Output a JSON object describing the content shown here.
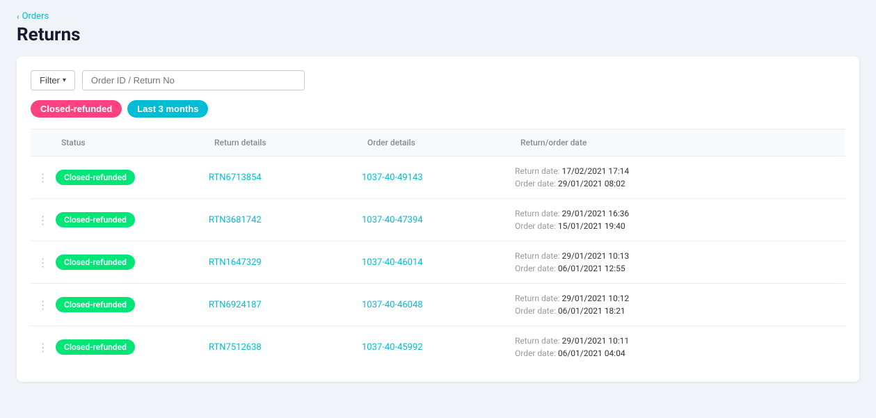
{
  "breadcrumb": {
    "chevron": "‹",
    "label": "Orders"
  },
  "page_title": "Returns",
  "filter": {
    "label": "Filter",
    "chevron": "▾",
    "placeholder": "Order ID / Return No"
  },
  "active_tags": [
    {
      "id": "tag-closed-refunded",
      "label": "Closed-refunded",
      "style": "pink"
    },
    {
      "id": "tag-last-3-months",
      "label": "Last 3 months",
      "style": "cyan"
    }
  ],
  "table": {
    "headers": [
      "",
      "Status",
      "Return details",
      "Order details",
      "Return/order date"
    ],
    "rows": [
      {
        "status": "Closed-refunded",
        "return_details": "RTN6713854",
        "order_details": "1037-40-49143",
        "return_date_label": "Return date:",
        "return_date_value": "17/02/2021 17:14",
        "order_date_label": "Order date:",
        "order_date_value": "29/01/2021 08:02"
      },
      {
        "status": "Closed-refunded",
        "return_details": "RTN3681742",
        "order_details": "1037-40-47394",
        "return_date_label": "Return date:",
        "return_date_value": "29/01/2021 16:36",
        "order_date_label": "Order date:",
        "order_date_value": "15/01/2021 19:40"
      },
      {
        "status": "Closed-refunded",
        "return_details": "RTN1647329",
        "order_details": "1037-40-46014",
        "return_date_label": "Return date:",
        "return_date_value": "29/01/2021 10:13",
        "order_date_label": "Order date:",
        "order_date_value": "06/01/2021 12:55"
      },
      {
        "status": "Closed-refunded",
        "return_details": "RTN6924187",
        "order_details": "1037-40-46048",
        "return_date_label": "Return date:",
        "return_date_value": "29/01/2021 10:12",
        "order_date_label": "Order date:",
        "order_date_value": "06/01/2021 18:21"
      },
      {
        "status": "Closed-refunded",
        "return_details": "RTN7512638",
        "order_details": "1037-40-45992",
        "return_date_label": "Return date:",
        "return_date_value": "29/01/2021 10:11",
        "order_date_label": "Order date:",
        "order_date_value": "06/01/2021 04:04"
      }
    ]
  }
}
